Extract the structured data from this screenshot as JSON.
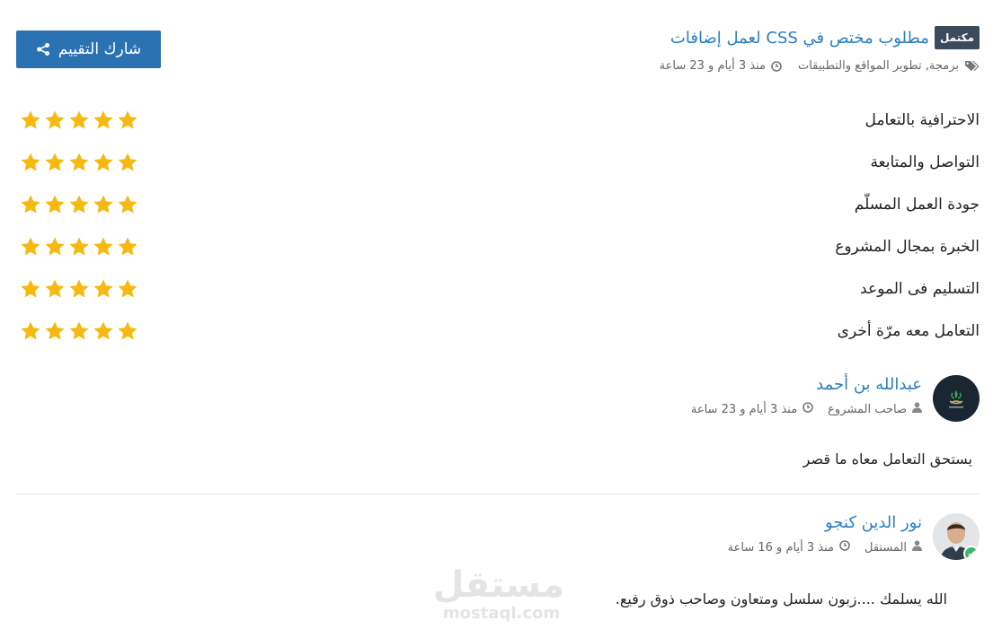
{
  "header": {
    "share_label": "شارك التقييم",
    "badge": "مكتمل",
    "title": "مطلوب مختص في CSS لعمل إضافات",
    "tags": "برمجة, تطوير المواقع والتطبيقات",
    "posted": "منذ 3 أيام و 23 ساعة"
  },
  "ratings": [
    {
      "label": "الاحترافية بالتعامل",
      "stars": 5
    },
    {
      "label": "التواصل والمتابعة",
      "stars": 5
    },
    {
      "label": "جودة العمل المسلّم",
      "stars": 5
    },
    {
      "label": "الخبرة بمجال المشروع",
      "stars": 5
    },
    {
      "label": "التسليم فى الموعد",
      "stars": 5
    },
    {
      "label": "التعامل معه مرّة أخرى",
      "stars": 5
    }
  ],
  "comments": [
    {
      "name": "عبدالله بن أحمد",
      "role": "صاحب المشروع",
      "time": "منذ 3 أيام و 23 ساعة",
      "text": "يستحق التعامل معاه ما قصر"
    },
    {
      "name": "نور الدين كنجو",
      "role": "المستقل",
      "time": "منذ 3 أيام و 16 ساعة",
      "text": "الله يسلمك ....زبون سلسل ومتعاون وصاحب ذوق رفيع."
    }
  ],
  "watermark": {
    "main": "مستقل",
    "sub": "mostaql.com"
  },
  "colors": {
    "accent": "#2b72b3",
    "link": "#2b7fc0",
    "star": "#f5b90f",
    "badge": "#3d4a5c",
    "verified": "#3fb36b"
  }
}
